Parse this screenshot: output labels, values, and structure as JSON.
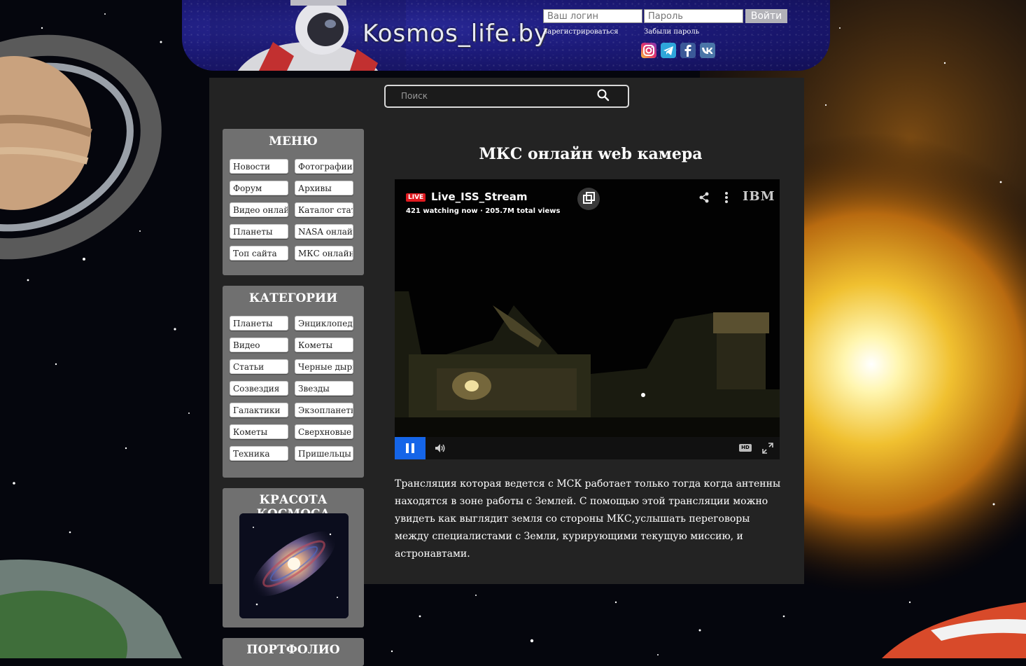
{
  "header": {
    "logo_text": "Kosmos_life.by",
    "login_placeholder": "Ваш логин",
    "password_placeholder": "Пароль",
    "login_button": "Войти",
    "register_link": "Зарегистрироваться",
    "forgot_link": "Забыли пароль",
    "social": [
      "instagram-icon",
      "telegram-icon",
      "facebook-icon",
      "vk-icon"
    ]
  },
  "search": {
    "placeholder": "Поиск"
  },
  "menu": {
    "title": "МЕНЮ",
    "items": [
      "Новости",
      "Фотографии",
      "Форум",
      "Архивы",
      "Видео онлайн",
      "Каталог статей",
      "Планеты",
      "NASA онлайн",
      "Топ сайта",
      "МКС онлайн"
    ]
  },
  "categories": {
    "title": "КАТЕГОРИИ",
    "items": [
      "Планеты",
      "Энциклопедии",
      "Видео",
      "Кометы",
      "Статьи",
      "Черные дыры",
      "Созвездия",
      "Звезды",
      "Галактики",
      "Экзопланеты",
      "Кометы",
      "Сверхновые",
      "Техника",
      "Пришельцы"
    ]
  },
  "beauty": {
    "title": "КРАСОТА КОСМОСА"
  },
  "portfolio": {
    "title": "ПОРТФОЛИО"
  },
  "content": {
    "title": "МКС онлайн web камера",
    "description": "Трансляция которая ведется с МСК работает только тогда когда антенны находятся в зоне работы с Землей. С помощью этой трансляции можно увидеть как выглядит земля со стороны МКС,услышать переговоры между специалистами с Земли, курирующими текущую миссию, и астронавтами."
  },
  "player": {
    "live_badge": "LIVE",
    "stream_title": "Live_ISS_Stream",
    "stats": "421 watching now · 205.7M total views",
    "brand": "IBM",
    "hd_label": "HD",
    "accent_color": "#1565e8"
  }
}
